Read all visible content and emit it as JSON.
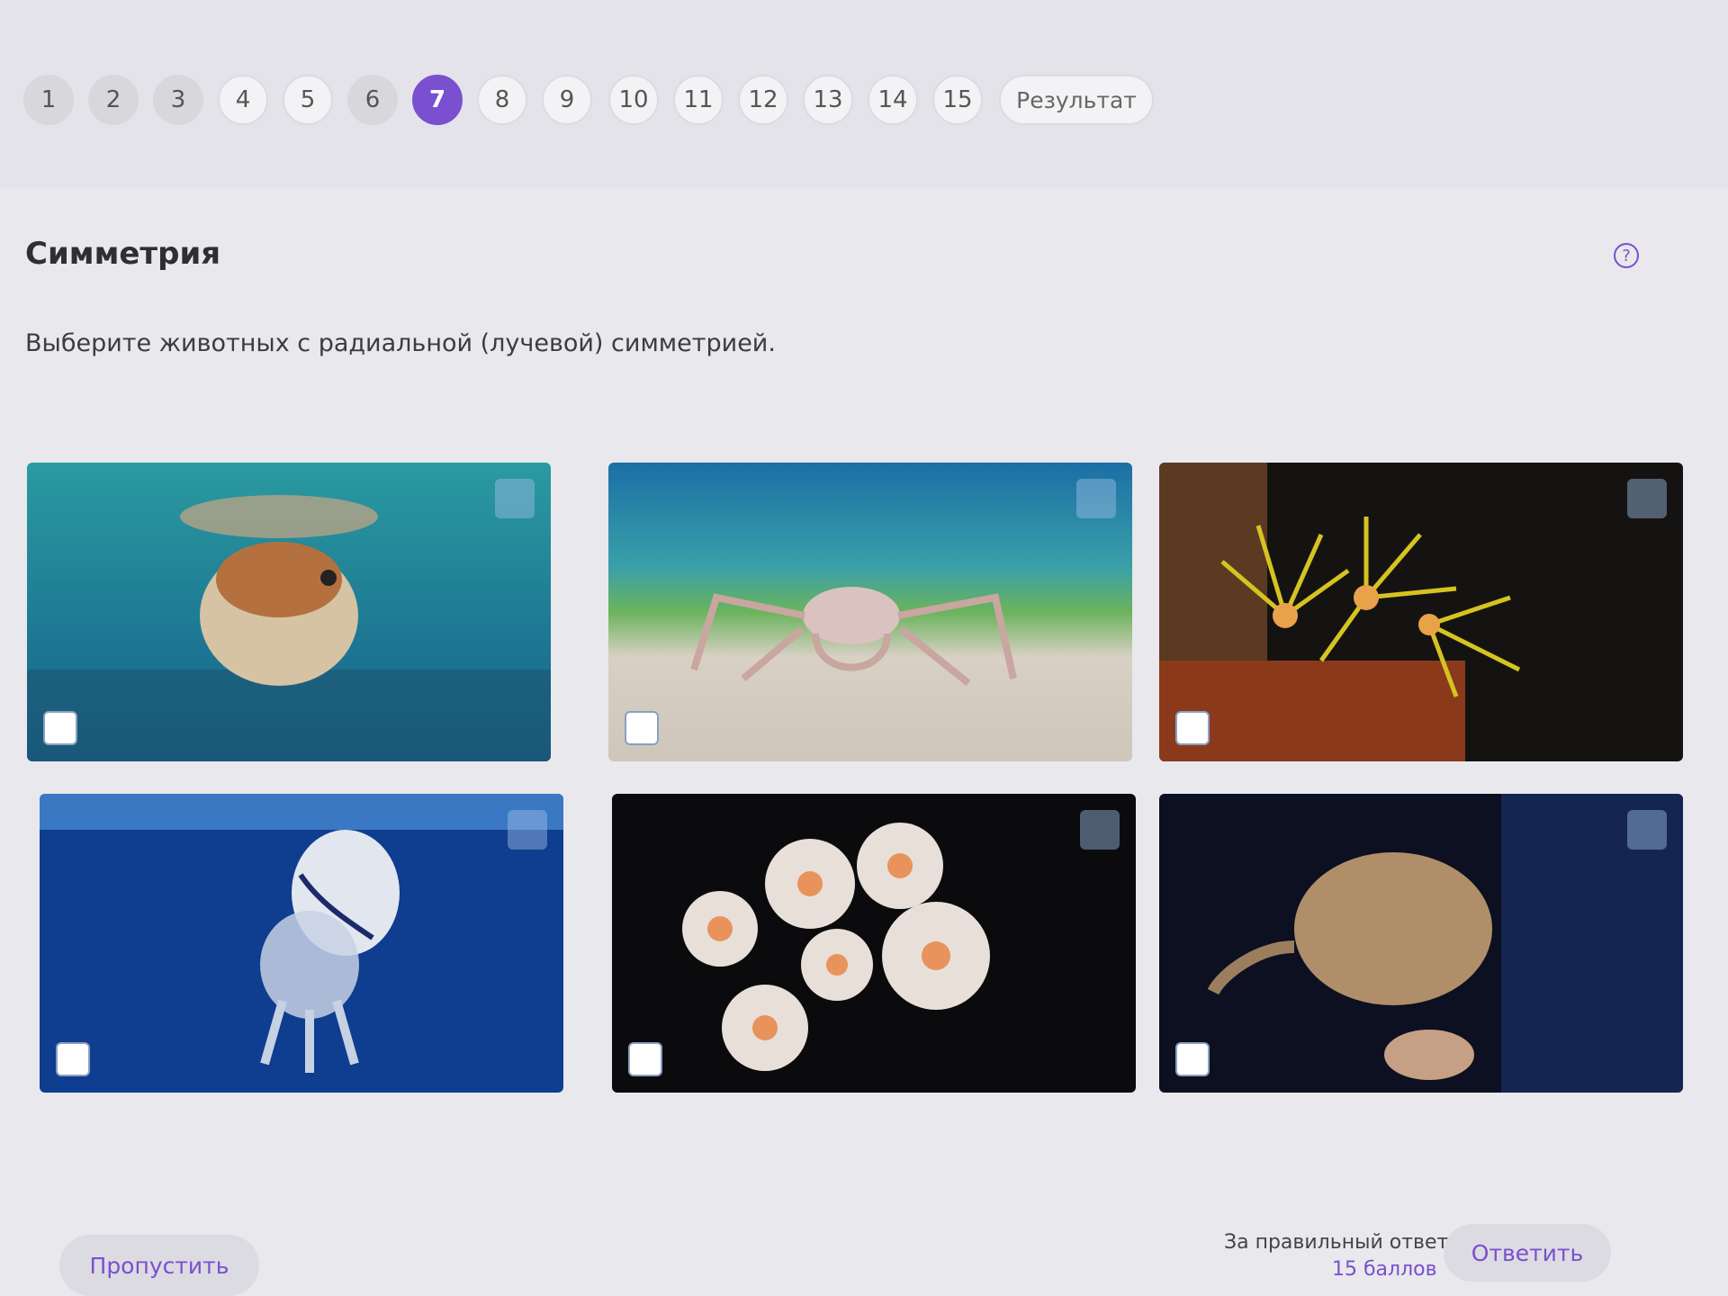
{
  "steps": {
    "items": [
      "1",
      "2",
      "3",
      "4",
      "5",
      "6",
      "7",
      "8",
      "9",
      "10",
      "11",
      "12",
      "13",
      "14",
      "15"
    ],
    "current": "7",
    "result_label": "Результат"
  },
  "question": {
    "title": "Симметрия",
    "text": "Выберите животных с радиальной (лучевой) симметрией."
  },
  "options": [
    {
      "subject": "pufferfish",
      "checked": false
    },
    {
      "subject": "spider-crab",
      "checked": false
    },
    {
      "subject": "yellow-zoanthids",
      "checked": false
    },
    {
      "subject": "jellyfish",
      "checked": false
    },
    {
      "subject": "sea-anemones",
      "checked": false
    },
    {
      "subject": "electric-ray",
      "checked": false
    }
  ],
  "footer": {
    "skip_label": "Пропустить",
    "reward_label": "За правильный ответ",
    "reward_points": "15 баллов",
    "answer_label": "Ответить"
  },
  "colors": {
    "accent": "#7a4fd0",
    "background": "#e9e8ed"
  }
}
